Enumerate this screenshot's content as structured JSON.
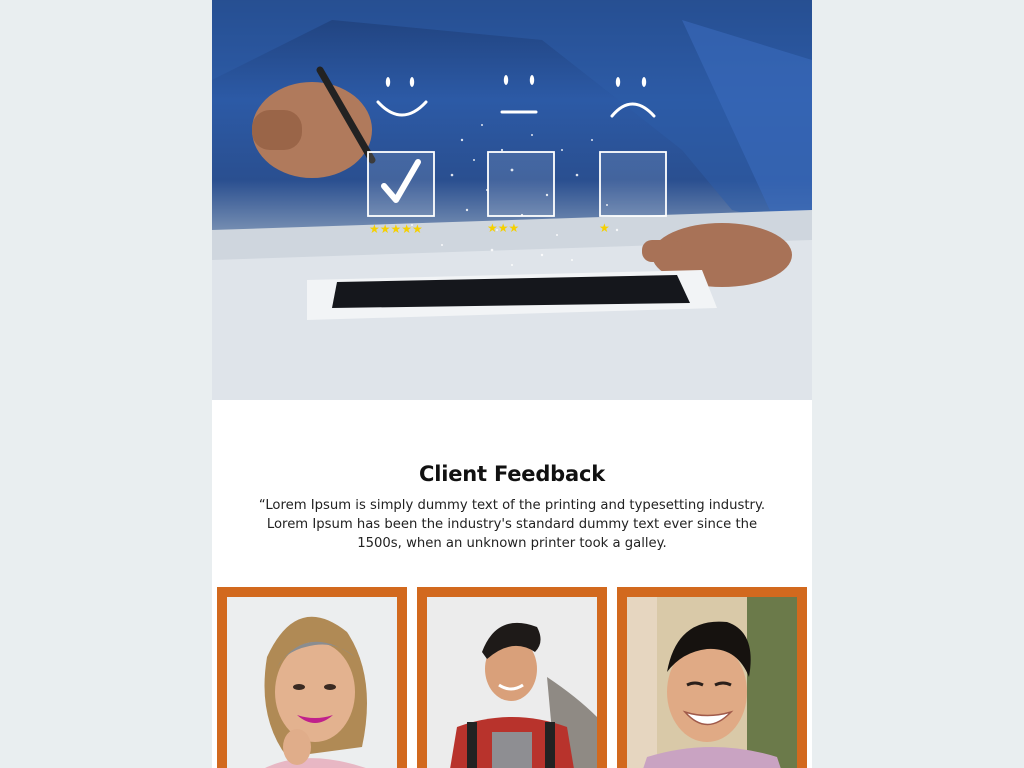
{
  "hero": {
    "image_name": "customer-satisfaction-rating-photo",
    "faces": [
      "smile",
      "neutral",
      "sad"
    ],
    "star_counts": [
      5,
      3,
      1
    ]
  },
  "feedback": {
    "title": "Client Feedback",
    "text": "“Lorem Ipsum is simply dummy text of the printing and typesetting industry. Lorem Ipsum has been the industry's standard dummy text ever since the 1500s, when an unknown printer took a galley."
  },
  "colors": {
    "page_bg": "#e9eef0",
    "card_frame": "#d2691e",
    "star": "#f5d000"
  },
  "clients": [
    {
      "photo": "woman-smiling-portrait"
    },
    {
      "photo": "man-backpack-portrait"
    },
    {
      "photo": "man-smiling-portrait"
    }
  ]
}
